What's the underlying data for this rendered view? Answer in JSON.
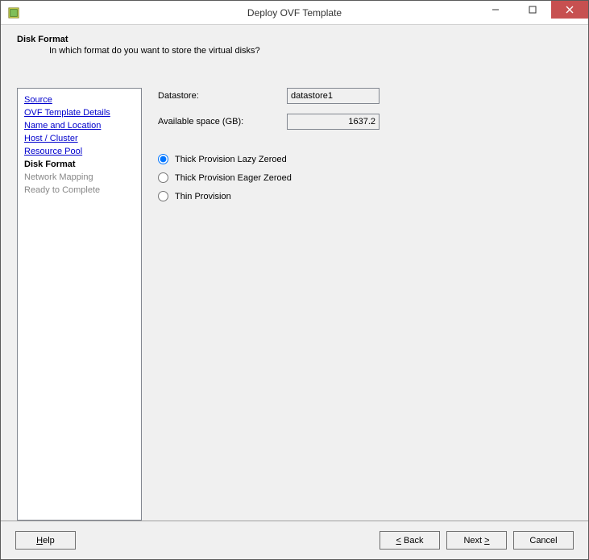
{
  "window": {
    "title": "Deploy OVF Template"
  },
  "header": {
    "title": "Disk Format",
    "subtitle": "In which format do you want to store the virtual disks?"
  },
  "sidebar": {
    "items": [
      {
        "label": "Source",
        "state": "link"
      },
      {
        "label": "OVF Template Details",
        "state": "link"
      },
      {
        "label": "Name and Location",
        "state": "link"
      },
      {
        "label": "Host / Cluster",
        "state": "link"
      },
      {
        "label": "Resource Pool",
        "state": "link"
      },
      {
        "label": "Disk Format",
        "state": "current"
      },
      {
        "label": "Network Mapping",
        "state": "future"
      },
      {
        "label": "Ready to Complete",
        "state": "future"
      }
    ]
  },
  "main": {
    "datastore_label": "Datastore:",
    "datastore_value": "datastore1",
    "available_label": "Available space (GB):",
    "available_value": "1637.2",
    "radios": [
      {
        "label": "Thick Provision Lazy Zeroed",
        "selected": true
      },
      {
        "label": "Thick Provision Eager Zeroed",
        "selected": false
      },
      {
        "label": "Thin Provision",
        "selected": false
      }
    ]
  },
  "footer": {
    "help": "Help",
    "back": "Back",
    "next": "Next",
    "cancel": "Cancel"
  }
}
